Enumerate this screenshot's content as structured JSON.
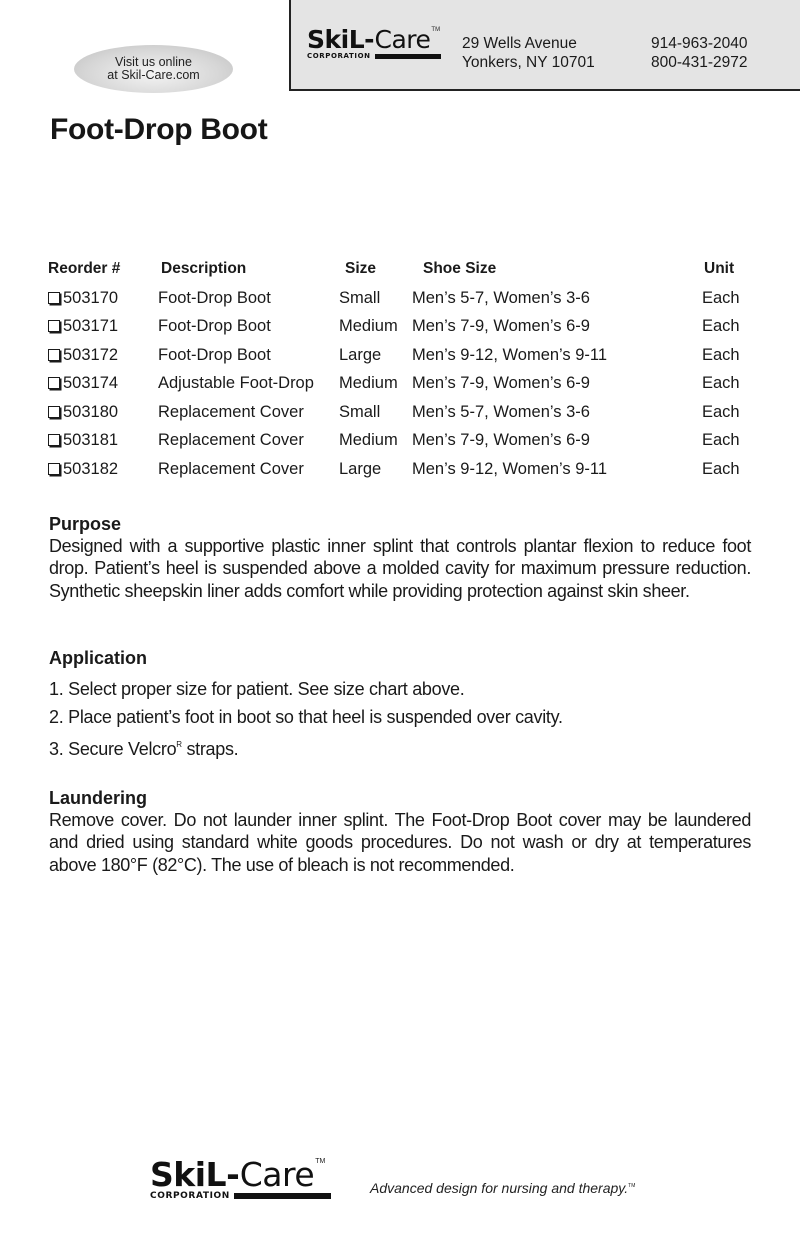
{
  "header": {
    "visit": {
      "line1": "Visit us online",
      "line2": "at Skil-Care.com"
    },
    "logo": {
      "brand_bold": "SkiL",
      "brand_dash": "-",
      "brand_light": "Care",
      "trademark": "TM",
      "subtitle": "CORPORATION"
    },
    "address": {
      "line1": "29 Wells Avenue",
      "line2": "Yonkers, NY 10701"
    },
    "phones": {
      "line1": "914-963-2040",
      "line2": "800-431-2972"
    }
  },
  "page": {
    "title": "Foot-Drop Boot"
  },
  "table": {
    "columns": {
      "reorder": "Reorder #",
      "description": "Description",
      "size": "Size",
      "shoe_size": "Shoe Size",
      "unit": "Unit"
    },
    "rows": [
      {
        "reorder": "503170",
        "description": "Foot-Drop Boot",
        "size": "Small",
        "shoe_size": "Men’s 5-7, Women’s 3-6",
        "unit": "Each",
        "checked": false
      },
      {
        "reorder": "503171",
        "description": "Foot-Drop Boot",
        "size": "Medium",
        "shoe_size": "Men’s 7-9, Women’s 6-9",
        "unit": "Each",
        "checked": false
      },
      {
        "reorder": "503172",
        "description": "Foot-Drop Boot",
        "size": "Large",
        "shoe_size": "Men’s 9-12, Women’s 9-11",
        "unit": "Each",
        "checked": false
      },
      {
        "reorder": "503174",
        "description": "Adjustable Foot-Drop",
        "size": "Medium",
        "shoe_size": "Men’s 7-9, Women’s 6-9",
        "unit": "Each",
        "checked": false
      },
      {
        "reorder": "503180",
        "description": "Replacement Cover",
        "size": "Small",
        "shoe_size": "Men’s 5-7, Women’s 3-6",
        "unit": "Each",
        "checked": false
      },
      {
        "reorder": "503181",
        "description": "Replacement Cover",
        "size": "Medium",
        "shoe_size": "Men’s 7-9, Women’s 6-9",
        "unit": "Each",
        "checked": false
      },
      {
        "reorder": "503182",
        "description": "Replacement Cover",
        "size": "Large",
        "shoe_size": "Men’s 9-12, Women’s 9-11",
        "unit": "Each",
        "checked": false
      }
    ]
  },
  "purpose": {
    "heading": "Purpose",
    "body": "Designed with a supportive plastic inner splint that controls plantar flexion to reduce foot drop. Patient’s heel is suspended above a molded cavity for maxi­mum pressure reduction. Synthetic sheepskin liner adds comfort while provid­ing protection against skin sheer."
  },
  "application": {
    "heading": "Application",
    "steps": [
      "1. Select proper size for patient. See size chart above.",
      "2. Place patient’s foot in boot so that heel is suspended over cavity."
    ],
    "step3_prefix": "3. Secure Velcro",
    "step3_mark": "R",
    "step3_suffix": " straps."
  },
  "laundering": {
    "heading": "Laundering",
    "body": "Remove cover. Do not launder inner splint. The Foot-Drop Boot cover may be laundered and dried using standard white goods procedures. Do not wash or dry at temperatures above 180°F (82°C). The use of bleach is not recom­mended."
  },
  "footer": {
    "logo": {
      "brand_bold": "SkiL",
      "brand_dash": "-",
      "brand_light": "Care",
      "trademark": "TM",
      "subtitle": "CORPORATION"
    },
    "tagline": "Advanced design for nursing and therapy.",
    "tagline_mark": "TM"
  }
}
